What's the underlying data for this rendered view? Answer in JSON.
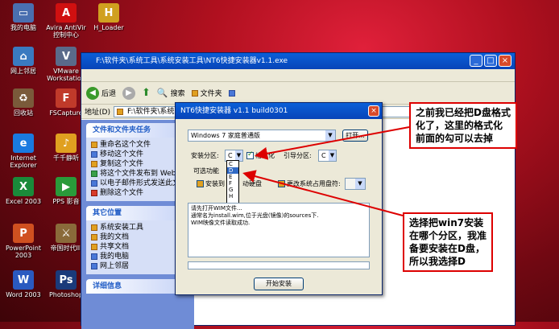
{
  "desktop_icons": [
    {
      "label": "我的电脑",
      "icon": "computer-icon",
      "color": "#4a6fb0",
      "glyph": "▭"
    },
    {
      "label": "网上邻居",
      "icon": "network-icon",
      "color": "#3a7ac0",
      "glyph": "⌂"
    },
    {
      "label": "回收站",
      "icon": "recycle-bin-icon",
      "color": "#7a5a3a",
      "glyph": "♻"
    },
    {
      "label": "Internet Explorer",
      "icon": "ie-icon",
      "color": "#1a7ae0",
      "glyph": "e"
    },
    {
      "label": "Excel 2003",
      "icon": "excel-icon",
      "color": "#1a8a3a",
      "glyph": "X"
    },
    {
      "label": "PowerPoint 2003",
      "icon": "powerpoint-icon",
      "color": "#d05020",
      "glyph": "P"
    },
    {
      "label": "Word 2003",
      "icon": "word-icon",
      "color": "#2a5ac0",
      "glyph": "W"
    },
    {
      "label": "Avira AntiVir 控制中心",
      "icon": "avira-icon",
      "color": "#d01010",
      "glyph": "A"
    },
    {
      "label": "VMware Workstation",
      "icon": "vmware-icon",
      "color": "#5a6a8a",
      "glyph": "V"
    },
    {
      "label": "FSCapture",
      "icon": "fscapture-icon",
      "color": "#c03a2a",
      "glyph": "F"
    },
    {
      "label": "千千静听",
      "icon": "ttplayer-icon",
      "color": "#e0a020",
      "glyph": "♪"
    },
    {
      "label": "PPS 影音",
      "icon": "pps-icon",
      "color": "#2a9a3a",
      "glyph": "▶"
    },
    {
      "label": "帝国时代III",
      "icon": "aoe-icon",
      "color": "#8a6a3a",
      "glyph": "⚔"
    },
    {
      "label": "Photoshop",
      "icon": "photoshop-icon",
      "color": "#1a3a7a",
      "glyph": "Ps"
    },
    {
      "label": "H_Loader",
      "icon": "hloader-icon",
      "color": "#d0a020",
      "glyph": "H"
    }
  ],
  "explorer": {
    "title": "F:\\软件夹\\系统工具\\系统安装工具\\NT6快捷安装器v1.1.exe",
    "toolbar": {
      "back": "后退",
      "search": "搜索",
      "folders": "文件夹"
    },
    "address_label": "地址(D)",
    "address_value": "F:\\软件夹\\系统工具\\",
    "file_tasks": {
      "header": "文件和文件夹任务",
      "items": [
        "重命名这个文件",
        "移动这个文件",
        "复制这个文件",
        "将这个文件发布到 Web",
        "以电子邮件形式发送此文件",
        "删除这个文件"
      ]
    },
    "other_places": {
      "header": "其它位置",
      "items": [
        "系统安装工具",
        "我的文档",
        "共享文档",
        "我的电脑",
        "网上邻居"
      ]
    },
    "details_header": "详细信息"
  },
  "nt6": {
    "title": "NT6快捷安装器 v1.1 build0301",
    "image_select": "Windows 7 家庭普通版",
    "open_button": "打开...",
    "install_partition_label": "安装分区:",
    "install_partition_value": "C",
    "format_label": "格式化",
    "boot_partition_label": "引导分区:",
    "boot_partition_value": "C",
    "optional_label": "可选功能",
    "install_to_removable": "安装到",
    "removable_suffix": "动硬盘",
    "change_letter": "更改系统占用盘符:",
    "dropdown_options": [
      "C",
      "D",
      "E",
      "F",
      "G",
      "H"
    ],
    "dropdown_selected": "D",
    "log_lines": [
      "请先打开WIM文件...",
      "通常名为install.wim,位于光盘(镜像)的sources下.",
      "WIM映像文件读取成功."
    ],
    "start_button": "开始安装"
  },
  "callouts": {
    "top": "之前我已经把D盘格式化了，这里的格式化前面的勾可以去掉",
    "bottom": "选择把win7安装在哪个分区，我准备要安装在D盘，所以我选择D"
  }
}
